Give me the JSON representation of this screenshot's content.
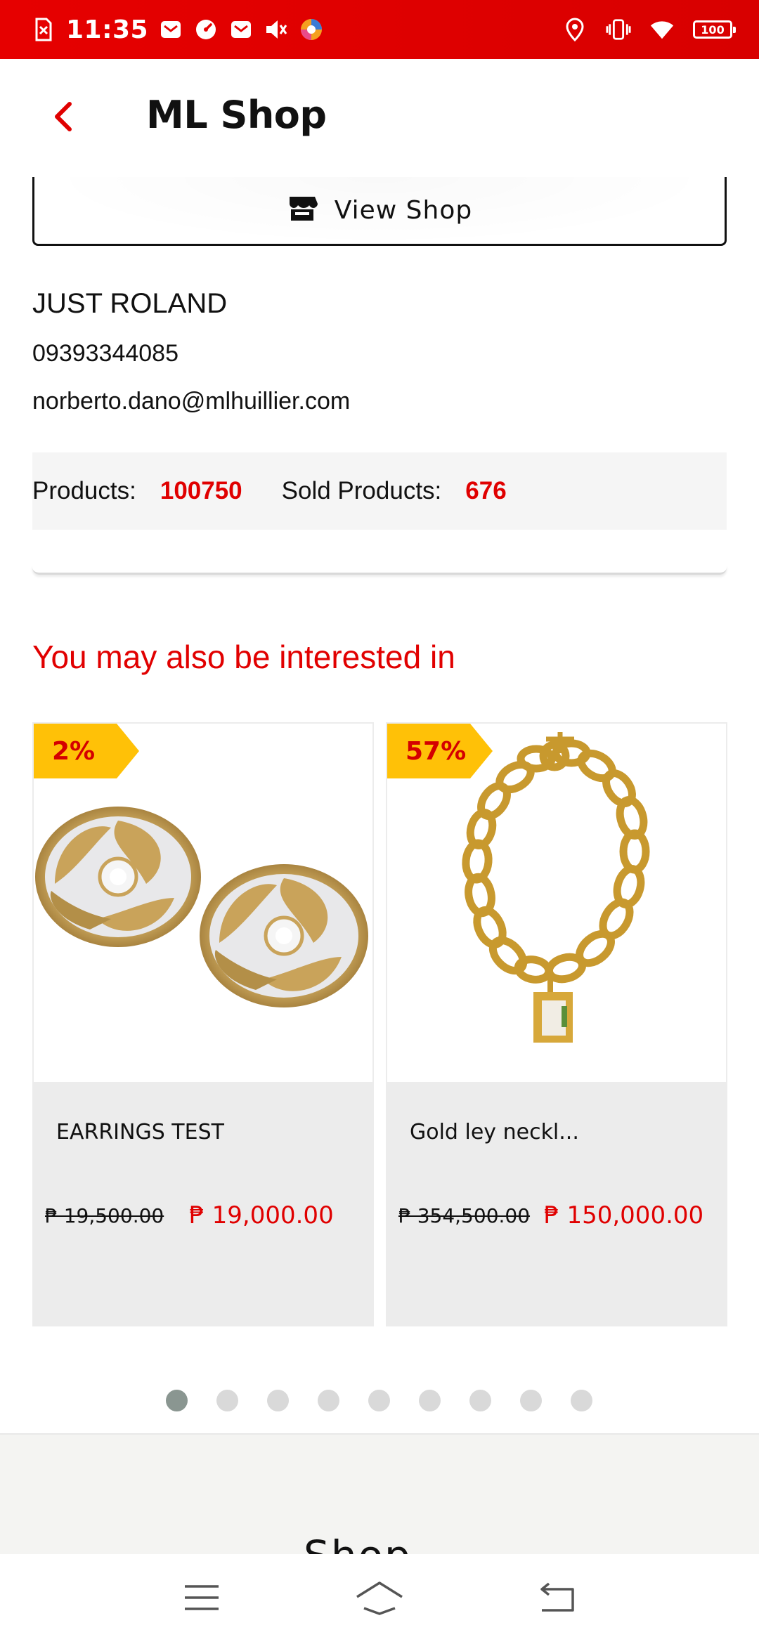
{
  "status_bar": {
    "time": "11:35",
    "battery": "100",
    "left_icons": [
      "sim-alert-icon",
      "mail-icon",
      "gauge-icon",
      "mail-icon",
      "speaker-mute-icon",
      "browser-icon"
    ],
    "right_icons": [
      "location-icon",
      "vibrate-icon",
      "wifi-icon",
      "battery-icon"
    ]
  },
  "app_bar": {
    "title": "ML Shop",
    "back_icon": "chevron-left-icon"
  },
  "view_shop": {
    "label": "View Shop",
    "icon": "storefront-icon"
  },
  "seller": {
    "name": "JUST ROLAND",
    "phone": "09393344085",
    "email": "norberto.dano@mlhuillier.com"
  },
  "stats": {
    "products_label": "Products:",
    "products_value": "100750",
    "sold_label": "Sold Products:",
    "sold_value": "676"
  },
  "recommendations": {
    "title": "You may also be interested in",
    "items": [
      {
        "badge": "2%",
        "name": "EARRINGS TEST",
        "price_old": "₱ 19,500.00",
        "price_new": "₱ 19,000.00",
        "image": "earrings-image"
      },
      {
        "badge": "57%",
        "name": "Gold ley neckl...",
        "price_old": "₱ 354,500.00",
        "price_new": "₱ 150,000.00",
        "image": "necklace-image"
      }
    ],
    "pager": {
      "total": 9,
      "active": 1
    }
  },
  "footer": {
    "title": "Shop"
  },
  "nav_bar": {
    "icons": [
      "menu-icon",
      "home-icon",
      "back-icon"
    ]
  },
  "colors": {
    "accent_red": "#e00000",
    "status_bar": "#e60000",
    "badge_yellow": "#ffc107",
    "card_info_bg": "#ececec",
    "dot_active": "#8a9691",
    "dot_inactive": "#d9d9d9"
  }
}
